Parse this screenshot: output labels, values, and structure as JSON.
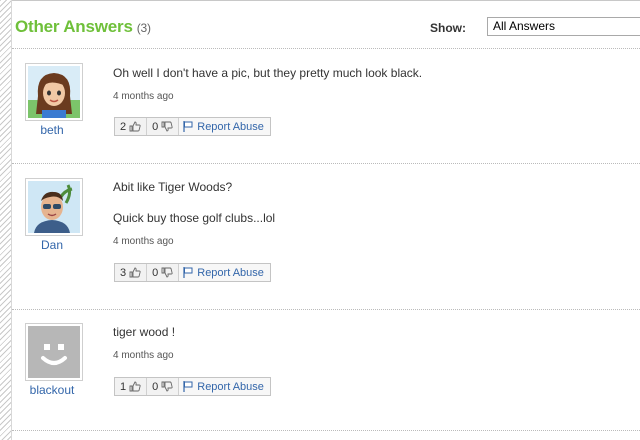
{
  "header": {
    "title": "Other Answers",
    "count": "(3)",
    "show_label": "Show:",
    "show_value": "All Answers"
  },
  "answers": [
    {
      "user": "beth",
      "lines": [
        "Oh well I don't have a pic, but they pretty much look black."
      ],
      "time": "4 months ago",
      "thumbs_up": "2",
      "thumbs_down": "0",
      "report_label": "Report Abuse"
    },
    {
      "user": "Dan",
      "lines": [
        "Abit like Tiger Woods?",
        "Quick buy those golf clubs...lol"
      ],
      "time": "4 months ago",
      "thumbs_up": "3",
      "thumbs_down": "0",
      "report_label": "Report Abuse"
    },
    {
      "user": "blackout",
      "lines": [
        "tiger wood !"
      ],
      "time": "4 months ago",
      "thumbs_up": "1",
      "thumbs_down": "0",
      "report_label": "Report Abuse"
    }
  ],
  "colors": {
    "title_green": "#6fc03a",
    "link_blue": "#3366aa"
  }
}
